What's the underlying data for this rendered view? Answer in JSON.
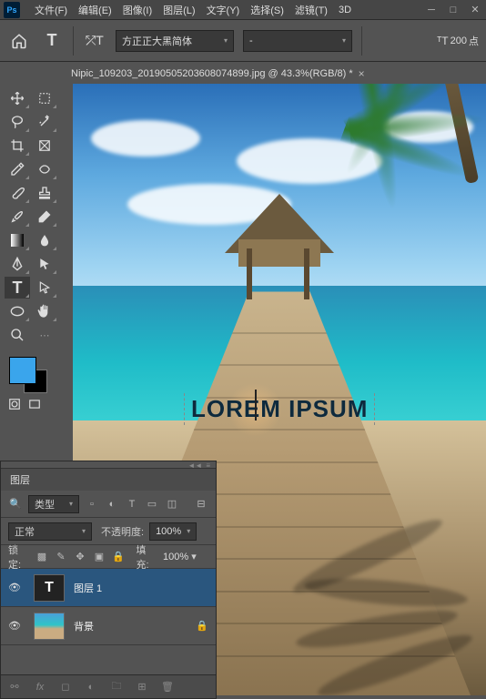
{
  "menubar": {
    "items": [
      "文件(F)",
      "编辑(E)",
      "图像(I)",
      "图层(L)",
      "文字(Y)",
      "选择(S)",
      "滤镜(T)",
      "3D"
    ],
    "logo": "Ps"
  },
  "optionsbar": {
    "font_family": "方正正大黑简体",
    "font_style": "-",
    "font_size_value": "200",
    "font_size_unit": "点"
  },
  "document": {
    "tab_title": "Nipic_109203_20190505203608074899.jpg @ 43.3%(RGB/8) *"
  },
  "canvas_text": {
    "content": "LOREM IPSUM"
  },
  "layers_panel": {
    "title": "图层",
    "filter_label": "类型",
    "blend_mode": "正常",
    "opacity_label": "不透明度:",
    "opacity_value": "100%",
    "lock_label": "锁定:",
    "fill_label": "填充:",
    "fill_value": "100%",
    "layers": [
      {
        "name": "图层 1",
        "kind": "text",
        "active": true,
        "locked": false
      },
      {
        "name": "背景",
        "kind": "image",
        "active": false,
        "locked": true
      }
    ]
  }
}
